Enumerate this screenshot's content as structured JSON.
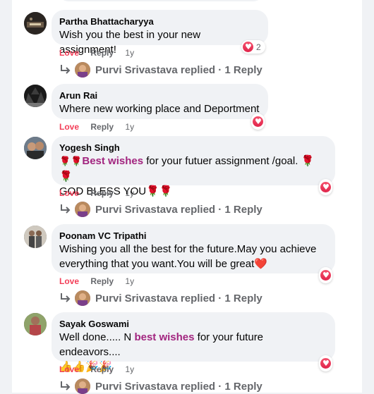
{
  "comments": [
    {
      "author": "Partha Bhattacharyya",
      "text": "Wish you the best in your new assignment!",
      "actions": {
        "love": "Love",
        "reply": "Reply",
        "time": "1y"
      },
      "reactions": {
        "icon": "heart-icon",
        "count": "2"
      },
      "replies": {
        "replier": "Purvi Srivastava",
        "text": "Purvi Srivastava replied · 1 Reply"
      }
    },
    {
      "author": "Arun Rai",
      "text": "Where new working place and Deportment",
      "actions": {
        "love": "Love",
        "reply": "Reply",
        "time": "1y"
      },
      "reactions": {
        "icon": "heart-icon"
      }
    },
    {
      "author": "Yogesh Singh",
      "text_prefix_emoji": "🌹🌹",
      "highlight": "Best wishes",
      "text_rest": " for your futuer assignment /goal. 🌹🌹",
      "text_line2": "GOD BLESS YOU🌹🌹",
      "actions": {
        "love": "Love",
        "reply": "Reply",
        "time": "1y"
      },
      "reactions": {
        "icon": "heart-icon"
      },
      "replies": {
        "replier": "Purvi Srivastava",
        "text": "Purvi Srivastava replied · 1 Reply"
      }
    },
    {
      "author": "Poonam VC Tripathi",
      "text_line1": "Wishing you all the best for the future.May you achieve",
      "text_line2": "everything that you want.You will be great❤️",
      "actions": {
        "love": "Love",
        "reply": "Reply",
        "time": "1y"
      },
      "reactions": {
        "icon": "heart-icon"
      },
      "replies": {
        "replier": "Purvi Srivastava",
        "text": "Purvi Srivastava replied · 1 Reply"
      }
    },
    {
      "author": "Sayak Goswami",
      "text_prefix": "Well done..... N ",
      "highlight": "best wishes",
      "text_rest": " for your future endeavors....",
      "text_line2": "👍👍🎉🎉",
      "actions": {
        "love": "Love",
        "reply": "Reply",
        "time": "1y"
      },
      "reactions": {
        "icon": "heart-icon"
      },
      "replies": {
        "replier": "Purvi Srivastava",
        "text": "Purvi Srivastava replied · 1 Reply"
      }
    }
  ],
  "colors": {
    "love": "#f33e58",
    "highlight": "#a2257f",
    "bubble": "#f0f2f5",
    "muted": "#65676b"
  }
}
